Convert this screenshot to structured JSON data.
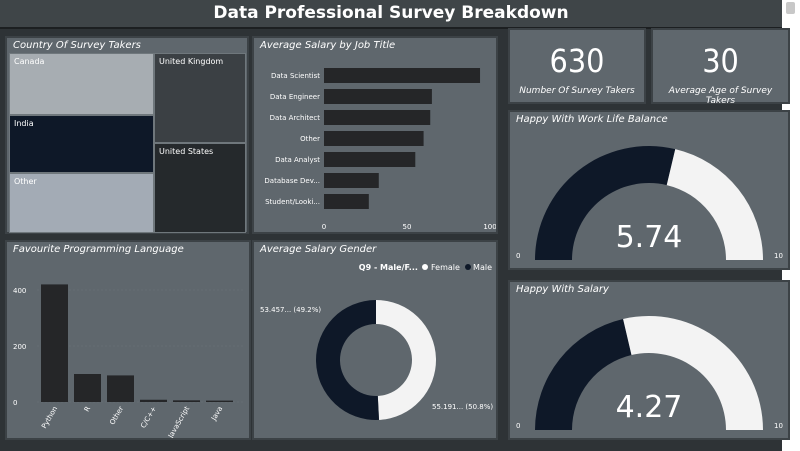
{
  "title": "Data Professional Survey Breakdown",
  "colors": {
    "dark": "#0e1828",
    "light": "#f3f3f3",
    "panel": "#5f676d",
    "bar": "#252628"
  },
  "country": {
    "title": "Country Of Survey Takers",
    "cells": [
      "Canada",
      "United Kingdom",
      "India",
      "United States",
      "Other"
    ]
  },
  "salary_by_job": {
    "title": "Average Salary by Job Title",
    "chart_data": {
      "type": "bar",
      "orientation": "horizontal",
      "categories": [
        "Data Scientist",
        "Data Engineer",
        "Data Architect",
        "Other",
        "Data Analyst",
        "Database Dev...",
        "Student/Looki..."
      ],
      "values": [
        94,
        65,
        64,
        60,
        55,
        33,
        27
      ],
      "xlim": [
        0,
        100
      ],
      "xticks": [
        "0",
        "50",
        "100"
      ]
    }
  },
  "cards": [
    {
      "value": "630",
      "label": "Number Of Survey Takers"
    },
    {
      "value": "30",
      "label": "Average Age of Survey Takers"
    }
  ],
  "work_life": {
    "title": "Happy With Work Life Balance",
    "value": "5.74",
    "min": "0",
    "max": "10",
    "fraction": 0.574
  },
  "happy_salary": {
    "title": "Happy With Salary",
    "value": "4.27",
    "min": "0",
    "max": "10",
    "fraction": 0.427
  },
  "languages": {
    "title": "Favourite Programming Language",
    "chart_data": {
      "type": "bar",
      "categories": [
        "Python",
        "R",
        "Other",
        "C/C++",
        "JavaScript",
        "Java"
      ],
      "values": [
        420,
        100,
        95,
        8,
        6,
        5
      ],
      "ylim": [
        0,
        500
      ],
      "yticks": [
        "400",
        "200",
        "0"
      ]
    }
  },
  "gender": {
    "title": "Average Salary Gender",
    "legend_title": "Q9 - Male/F...",
    "legend_items": [
      "Female",
      "Male"
    ],
    "label_left": "53.457... (49.2%)",
    "label_right": "55.191... (50.8%)",
    "chart_data": {
      "type": "pie",
      "categories": [
        "Female",
        "Male"
      ],
      "values": [
        53.457,
        55.191
      ],
      "percent": [
        49.2,
        50.8
      ]
    }
  }
}
